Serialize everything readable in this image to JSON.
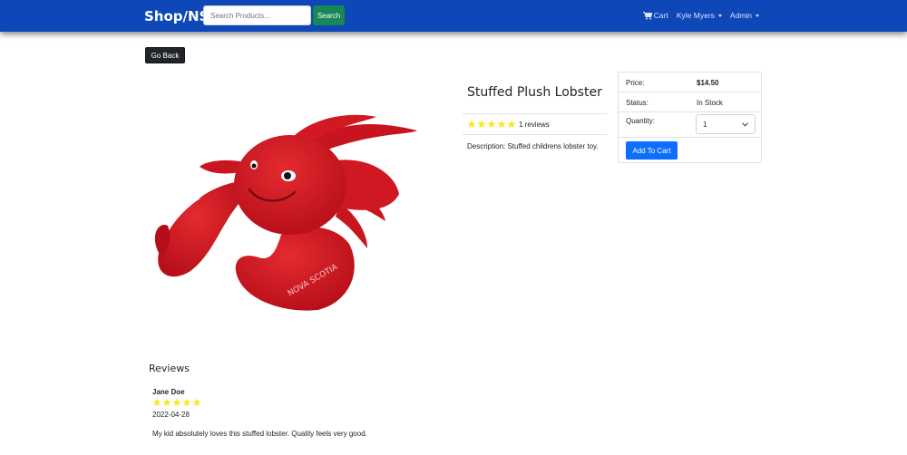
{
  "navbar": {
    "brand": "Shop/NS",
    "search_placeholder": "Search Products...",
    "search_button": "Search",
    "cart_label": "Cart",
    "user_label": "Kyle Myers",
    "admin_label": "Admin"
  },
  "back_button": "Go Back",
  "product": {
    "name": "Stuffed Plush Lobster",
    "rating": 5,
    "reviews_text": "1 reviews",
    "description": "Description: Stuffed childrens lobster toy.",
    "image_text": "NOVA SCOTIA"
  },
  "purchase_panel": {
    "price_label": "Price:",
    "price_value": "$14.50",
    "status_label": "Status:",
    "status_value": "In Stock",
    "quantity_label": "Quantity:",
    "quantity_value": "1",
    "add_button": "Add To Cart"
  },
  "reviews": {
    "heading": "Reviews",
    "items": [
      {
        "name": "Jane Doe",
        "rating": 5,
        "date": "2022-04-28",
        "comment": "My kid absolutely loves this stuffed lobster. Quality feels very good."
      }
    ]
  },
  "colors": {
    "navbar": "#0d47b8",
    "search_button": "#198754",
    "add_button": "#0d6efd",
    "star": "#f8e825",
    "lobster": "#d3141f"
  }
}
